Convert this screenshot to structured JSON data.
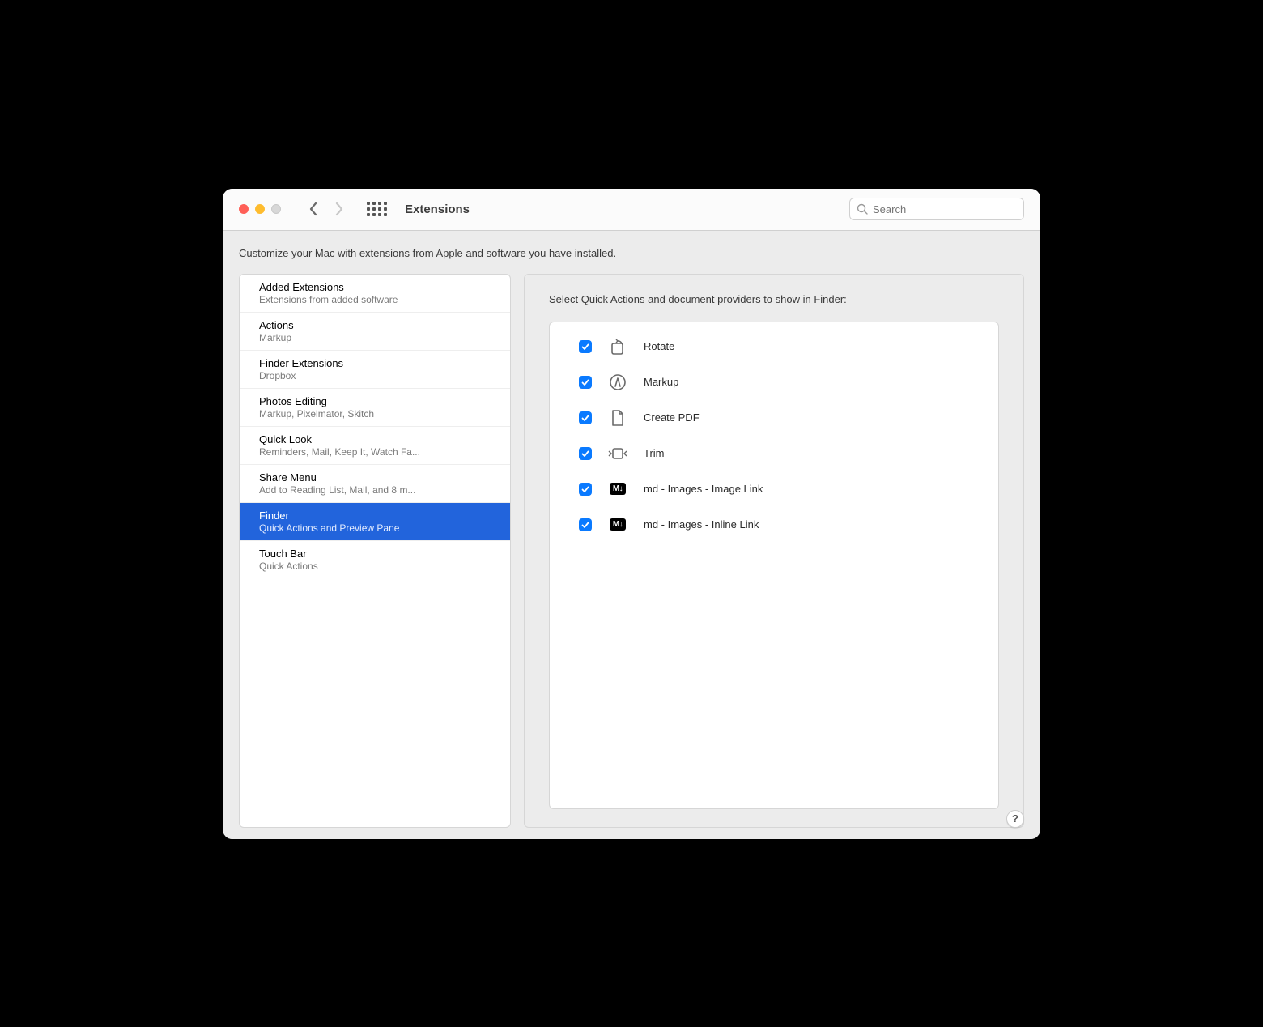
{
  "window": {
    "title": "Extensions",
    "search_placeholder": "Search"
  },
  "description": "Customize your Mac with extensions from Apple and software you have installed.",
  "sidebar": {
    "items": [
      {
        "title": "Added Extensions",
        "subtitle": "Extensions from added software",
        "selected": false
      },
      {
        "title": "Actions",
        "subtitle": "Markup",
        "selected": false
      },
      {
        "title": "Finder Extensions",
        "subtitle": "Dropbox",
        "selected": false
      },
      {
        "title": "Photos Editing",
        "subtitle": "Markup, Pixelmator, Skitch",
        "selected": false
      },
      {
        "title": "Quick Look",
        "subtitle": "Reminders, Mail, Keep It, Watch Fa...",
        "selected": false
      },
      {
        "title": "Share Menu",
        "subtitle": "Add to Reading List, Mail, and 8 m...",
        "selected": false
      },
      {
        "title": "Finder",
        "subtitle": "Quick Actions and Preview Pane",
        "selected": true
      },
      {
        "title": "Touch Bar",
        "subtitle": "Quick Actions",
        "selected": false
      }
    ]
  },
  "detail": {
    "header": "Select Quick Actions and document providers to show in Finder:",
    "actions": [
      {
        "checked": true,
        "icon": "rotate",
        "label": "Rotate"
      },
      {
        "checked": true,
        "icon": "markup",
        "label": "Markup"
      },
      {
        "checked": true,
        "icon": "pdf",
        "label": "Create PDF"
      },
      {
        "checked": true,
        "icon": "trim",
        "label": "Trim"
      },
      {
        "checked": true,
        "icon": "md",
        "label": "md - Images - Image Link"
      },
      {
        "checked": true,
        "icon": "md",
        "label": "md - Images - Inline Link"
      }
    ]
  },
  "help_label": "?"
}
